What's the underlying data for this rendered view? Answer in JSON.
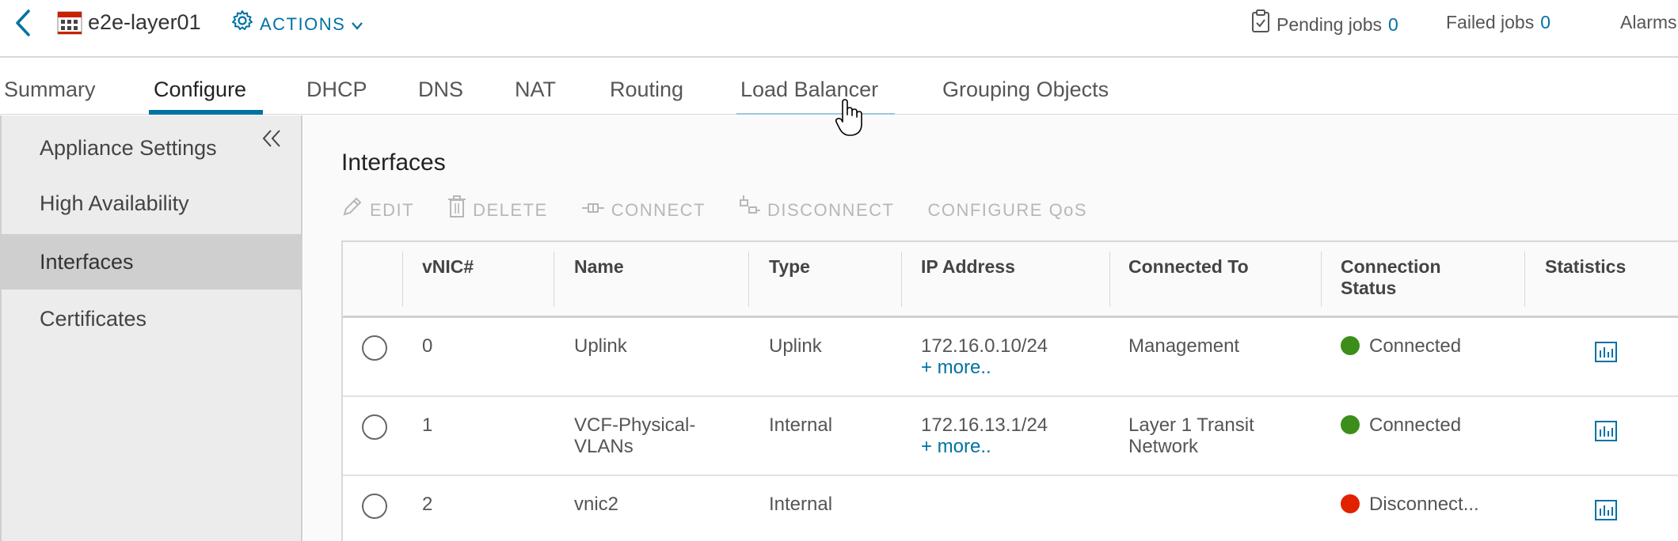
{
  "header": {
    "object_name": "e2e-layer01",
    "actions_label": "ACTIONS",
    "pending_jobs_label": "Pending jobs",
    "pending_jobs_count": "0",
    "failed_jobs_label": "Failed jobs",
    "failed_jobs_count": "0",
    "alarms_label": "Alarms"
  },
  "tabs": [
    {
      "label": "Summary"
    },
    {
      "label": "Configure"
    },
    {
      "label": "DHCP"
    },
    {
      "label": "DNS"
    },
    {
      "label": "NAT"
    },
    {
      "label": "Routing"
    },
    {
      "label": "Load Balancer"
    },
    {
      "label": "Grouping Objects"
    }
  ],
  "active_tab": "Configure",
  "sidebar": {
    "items": [
      {
        "label": "Appliance Settings"
      },
      {
        "label": "High Availability"
      },
      {
        "label": "Interfaces"
      },
      {
        "label": "Certificates"
      }
    ],
    "active_item": "Interfaces"
  },
  "main": {
    "title": "Interfaces",
    "toolbar": {
      "edit": "EDIT",
      "delete": "DELETE",
      "connect": "CONNECT",
      "disconnect": "DISCONNECT",
      "configure_qos": "CONFIGURE QoS"
    },
    "columns": {
      "vnic": "vNIC#",
      "name": "Name",
      "type": "Type",
      "ip": "IP Address",
      "connected_to": "Connected To",
      "status_line1": "Connection",
      "status_line2": "Status",
      "statistics": "Statistics"
    },
    "rows": [
      {
        "vnic": "0",
        "name": "Uplink",
        "type": "Uplink",
        "ip": "172.16.0.10/24",
        "more": "+ more..",
        "connected_to": "Management",
        "status": "Connected"
      },
      {
        "vnic": "1",
        "name": "VCF-Physical-VLANs",
        "type": "Internal",
        "ip": "172.16.13.1/24",
        "more": "+ more..",
        "connected_to": "Layer 1 Transit Network",
        "status": "Connected"
      },
      {
        "vnic": "2",
        "name": "vnic2",
        "type": "Internal",
        "ip": "",
        "more": "",
        "connected_to": "",
        "status": "Disconnect..."
      }
    ]
  },
  "colors": {
    "accent": "#0072a3",
    "connected": "#3c8d1a",
    "disconnected": "#e12200",
    "disabled_text": "#b7b7b7"
  },
  "icons": {
    "back": "chevron-left-icon",
    "object": "edge-gateway-icon",
    "actions": "gear-icon",
    "jobs": "clipboard-check-icon",
    "collapse": "double-chevron-left-icon",
    "statistics": "bar-chart-icon"
  }
}
